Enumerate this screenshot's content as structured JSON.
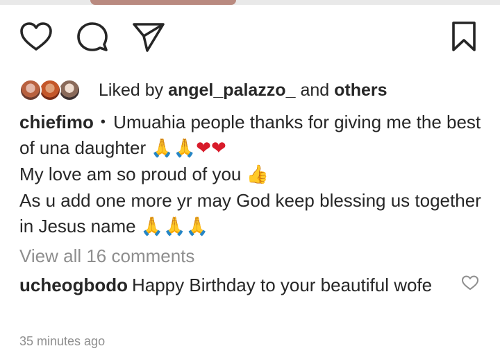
{
  "icons": {
    "like": "heart-outline-icon",
    "comment": "speech-bubble-icon",
    "share": "paper-plane-icon",
    "save": "bookmark-icon",
    "comment_like": "small-heart-outline-icon"
  },
  "likes": {
    "prefix": "Liked by",
    "user": "angel_palazzo_",
    "conjunction": "and",
    "others": "others"
  },
  "caption": {
    "username": "chiefimo",
    "bullet": "•",
    "line1_text": "Umuahia people thanks for giving me the best of una daughter",
    "line1_emoji": "🙏🙏❤❤",
    "line2_text": "My love am so proud of you",
    "line2_emoji": "👍",
    "line3_text": "As u add one more yr may God keep blessing us together in Jesus name",
    "line3_emoji": "🙏🙏🙏"
  },
  "view_all_comments": "View all 16 comments",
  "top_comment": {
    "username": "ucheogbodo",
    "text": "Happy Birthday to your beautiful wofe"
  },
  "timestamp": "35 minutes ago",
  "colors": {
    "text": "#262626",
    "muted": "#8e8e8e",
    "heart_red": "#d81b2a",
    "emoji_yellow": "#f2b233"
  }
}
